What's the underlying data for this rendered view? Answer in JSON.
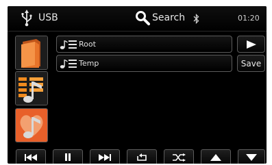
{
  "header": {
    "source_label": "USB",
    "search_label": "Search",
    "clock": "01:20",
    "icons": [
      "usb-icon",
      "search-icon",
      "bluetooth-icon"
    ]
  },
  "source_tiles": [
    {
      "name": "folder-browse",
      "icon": "folder-icon"
    },
    {
      "name": "playlist-browse",
      "icon": "music-list-icon"
    },
    {
      "name": "favorites-browse",
      "icon": "heart-music-icon"
    }
  ],
  "list": {
    "items": [
      {
        "label": "Root",
        "icon": "music-list-icon"
      },
      {
        "label": "Temp",
        "icon": "music-list-icon"
      }
    ]
  },
  "side_buttons": {
    "play_icon": "play-icon",
    "save_label": "Save"
  },
  "controls": [
    "previous-icon",
    "pause-icon",
    "next-icon",
    "repeat-icon",
    "shuffle-icon",
    "scroll-up-icon",
    "scroll-down-icon"
  ],
  "colors": {
    "folder": "#e8742a",
    "playlist": "#f08a1e",
    "favorites": "#e8602a",
    "screen": "#000000",
    "accent_text": "#e8e8e8"
  }
}
